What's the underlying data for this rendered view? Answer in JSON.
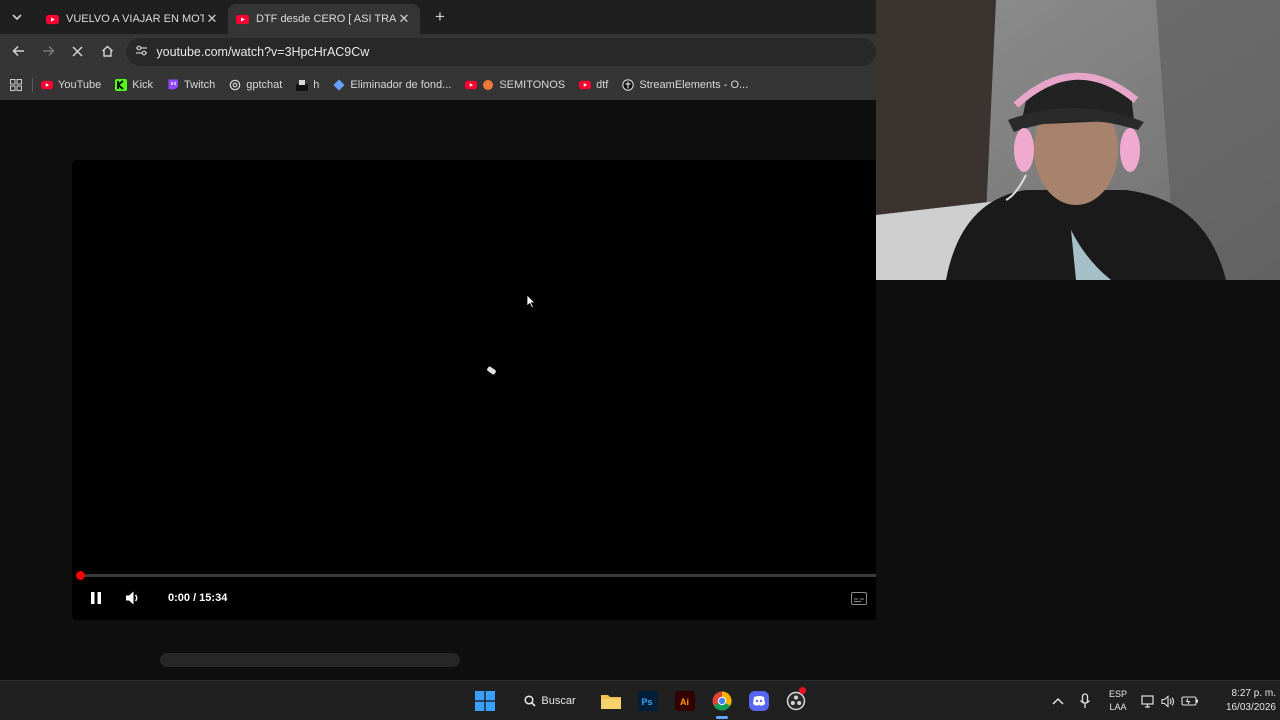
{
  "browser": {
    "tabs": [
      {
        "title": "VUELVO A VIAJAR EN MOTO",
        "active": false,
        "favicon": "youtube-icon"
      },
      {
        "title": "DTF desde CERO [ ASI TRAB",
        "active": true,
        "favicon": "youtube-icon"
      }
    ],
    "url": "youtube.com/watch?v=3HpcHrAC9Cw",
    "bookmarks": [
      {
        "label": "YouTube",
        "icon": "youtube-icon"
      },
      {
        "label": "Kick",
        "icon": "kick-icon"
      },
      {
        "label": "Twitch",
        "icon": "twitch-icon"
      },
      {
        "label": "gptchat",
        "icon": "openai-icon"
      },
      {
        "label": "h",
        "icon": "bookmark-icon"
      },
      {
        "label": "Eliminador de fond...",
        "icon": "diamond-icon"
      },
      {
        "label": "SEMITONOS",
        "icon": "youtube-icon"
      },
      {
        "label": "dtf",
        "icon": "youtube-icon"
      },
      {
        "label": "StreamElements - O...",
        "icon": "streamelements-icon"
      }
    ]
  },
  "player": {
    "time": "0:00 / 15:34",
    "progress": 0.0,
    "state": "loading"
  },
  "taskbar": {
    "search_label": "Buscar",
    "lang_top": "ESP",
    "lang_bottom": "LAA",
    "time": "8:27 p. m.",
    "date": "16/03/2026"
  },
  "colors": {
    "youtube_red": "#ff0000",
    "kick_green": "#53fc18",
    "twitch_purple": "#9146ff"
  }
}
